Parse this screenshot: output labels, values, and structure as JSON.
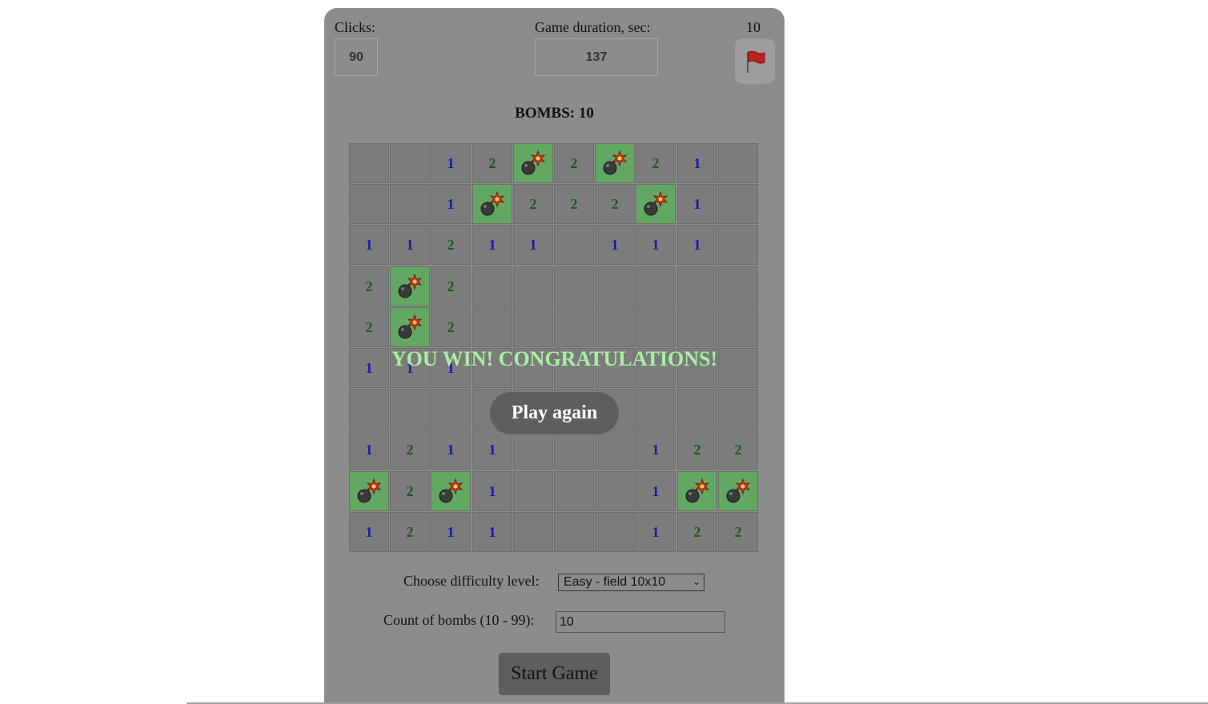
{
  "header": {
    "clicks_label": "Clicks:",
    "clicks_value": "90",
    "duration_label": "Game duration, sec:",
    "duration_value": "137",
    "flags_count": "10",
    "flag_icon": "flag-icon"
  },
  "bombs_title": "BOMBS: 10",
  "board": {
    "rows": [
      [
        "",
        "",
        "1",
        "2",
        "B",
        "2",
        "B",
        "2",
        "1",
        ""
      ],
      [
        "",
        "",
        "1",
        "B",
        "2",
        "2",
        "2",
        "B",
        "1",
        ""
      ],
      [
        "1",
        "1",
        "2",
        "1",
        "1",
        "",
        "1",
        "1",
        "1",
        ""
      ],
      [
        "2",
        "B",
        "2",
        "",
        "",
        "",
        "",
        "",
        "",
        ""
      ],
      [
        "2",
        "B",
        "2",
        "",
        "",
        "",
        "",
        "",
        "",
        ""
      ],
      [
        "1",
        "1",
        "1",
        "",
        "",
        "",
        "",
        "",
        "",
        ""
      ],
      [
        "",
        "",
        "",
        "",
        "",
        "",
        "",
        "",
        "",
        ""
      ],
      [
        "1",
        "2",
        "1",
        "1",
        "",
        "",
        "",
        "1",
        "2",
        "2"
      ],
      [
        "B",
        "2",
        "B",
        "1",
        "",
        "",
        "",
        "1",
        "B",
        "B"
      ],
      [
        "1",
        "2",
        "1",
        "1",
        "",
        "",
        "",
        "1",
        "2",
        "2"
      ]
    ],
    "bomb_icon": "bomb-icon",
    "colors": {
      "one": "#1a1aa8",
      "two": "#1a5a1a",
      "bomb_cell": "#62a862",
      "cell": "#7c7c7c"
    }
  },
  "overlay": {
    "message": "YOU WIN! CONGRATULATIONS!",
    "play_again": "Play again"
  },
  "controls": {
    "difficulty_label": "Choose difficulty level:",
    "difficulty_value": "Easy - field 10x10",
    "bombs_label": "Count of bombs (10 - 99):",
    "bombs_value": "10",
    "start_label": "Start Game"
  }
}
